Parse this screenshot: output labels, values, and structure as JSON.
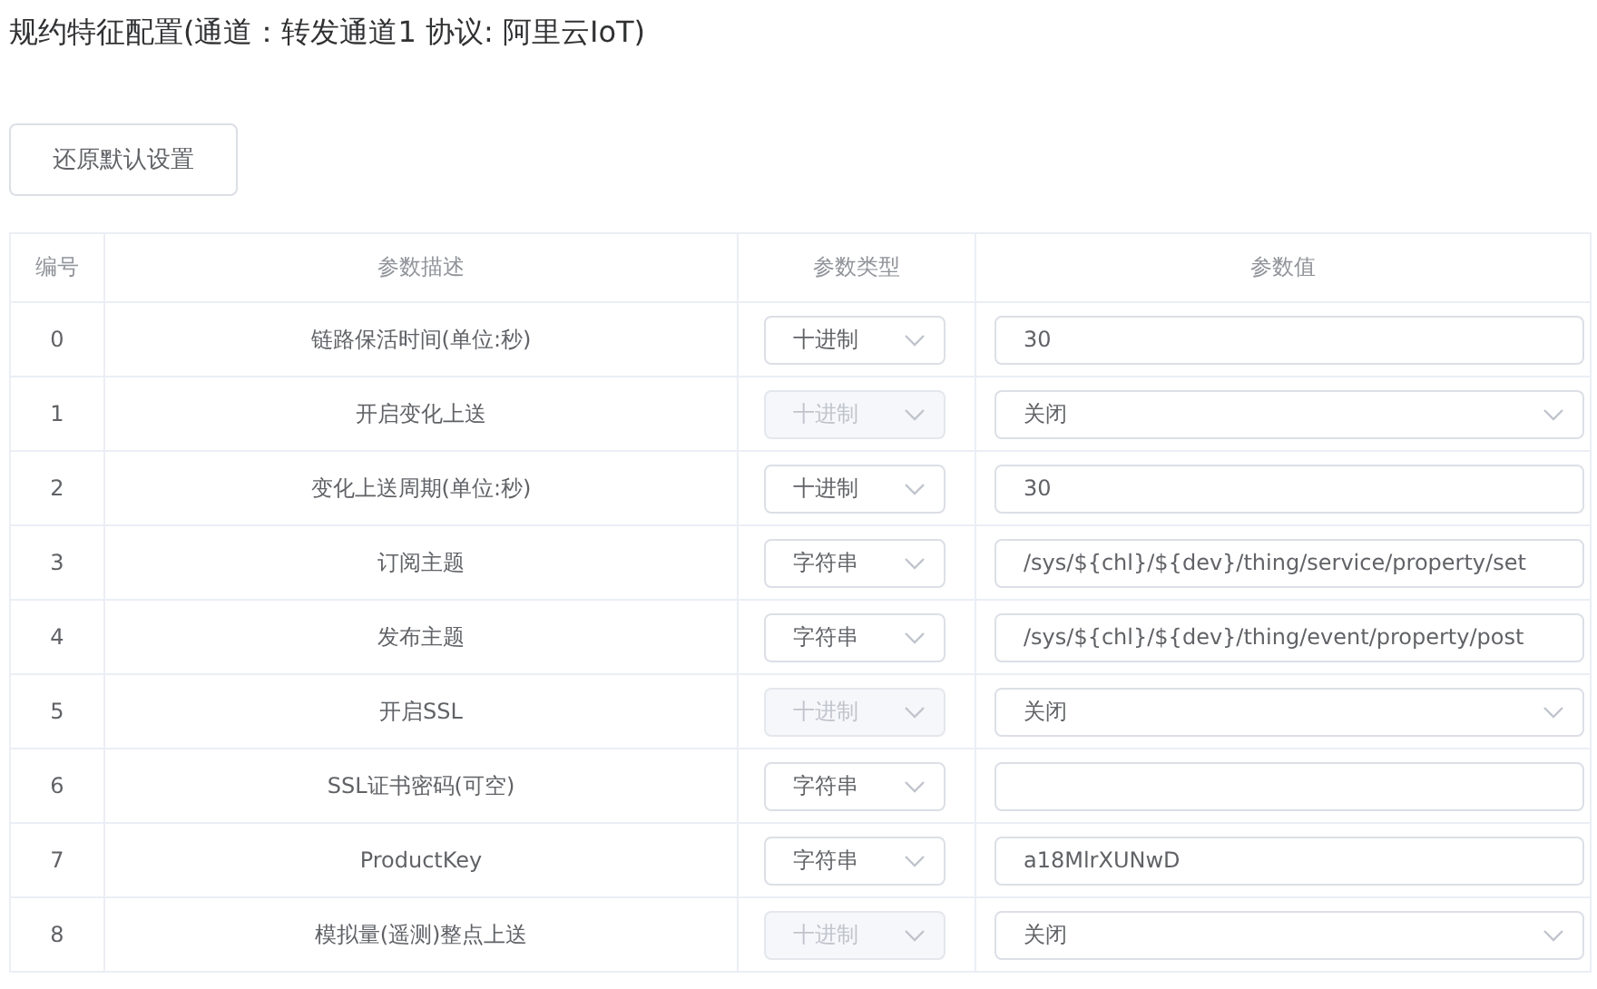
{
  "title": "规约特征配置(通道：转发通道1 协议: 阿里云IoT)",
  "restore_button": "还原默认设置",
  "table": {
    "columns": [
      "编号",
      "参数描述",
      "参数类型",
      "参数值"
    ],
    "rows": [
      {
        "index": "0",
        "description": "链路保活时间(单位:秒)",
        "type": {
          "value": "十进制",
          "disabled": false
        },
        "value": {
          "kind": "input",
          "text": "30"
        }
      },
      {
        "index": "1",
        "description": "开启变化上送",
        "type": {
          "value": "十进制",
          "disabled": true
        },
        "value": {
          "kind": "select",
          "text": "关闭"
        }
      },
      {
        "index": "2",
        "description": "变化上送周期(单位:秒)",
        "type": {
          "value": "十进制",
          "disabled": false
        },
        "value": {
          "kind": "input",
          "text": "30"
        }
      },
      {
        "index": "3",
        "description": "订阅主题",
        "type": {
          "value": "字符串",
          "disabled": false
        },
        "value": {
          "kind": "input",
          "text": "/sys/${chl}/${dev}/thing/service/property/set"
        }
      },
      {
        "index": "4",
        "description": "发布主题",
        "type": {
          "value": "字符串",
          "disabled": false
        },
        "value": {
          "kind": "input",
          "text": "/sys/${chl}/${dev}/thing/event/property/post"
        }
      },
      {
        "index": "5",
        "description": "开启SSL",
        "type": {
          "value": "十进制",
          "disabled": true
        },
        "value": {
          "kind": "select",
          "text": "关闭"
        }
      },
      {
        "index": "6",
        "description": "SSL证书密码(可空)",
        "type": {
          "value": "字符串",
          "disabled": false
        },
        "value": {
          "kind": "input"
        }
      },
      {
        "index": "7",
        "description": "ProductKey",
        "type": {
          "value": "字符串",
          "disabled": false
        },
        "value": {
          "kind": "input",
          "text": "a18MlrXUNwD"
        }
      },
      {
        "index": "8",
        "description": "模拟量(遥测)整点上送",
        "type": {
          "value": "十进制",
          "disabled": true
        },
        "value": {
          "kind": "select",
          "text": "关闭"
        }
      }
    ]
  }
}
